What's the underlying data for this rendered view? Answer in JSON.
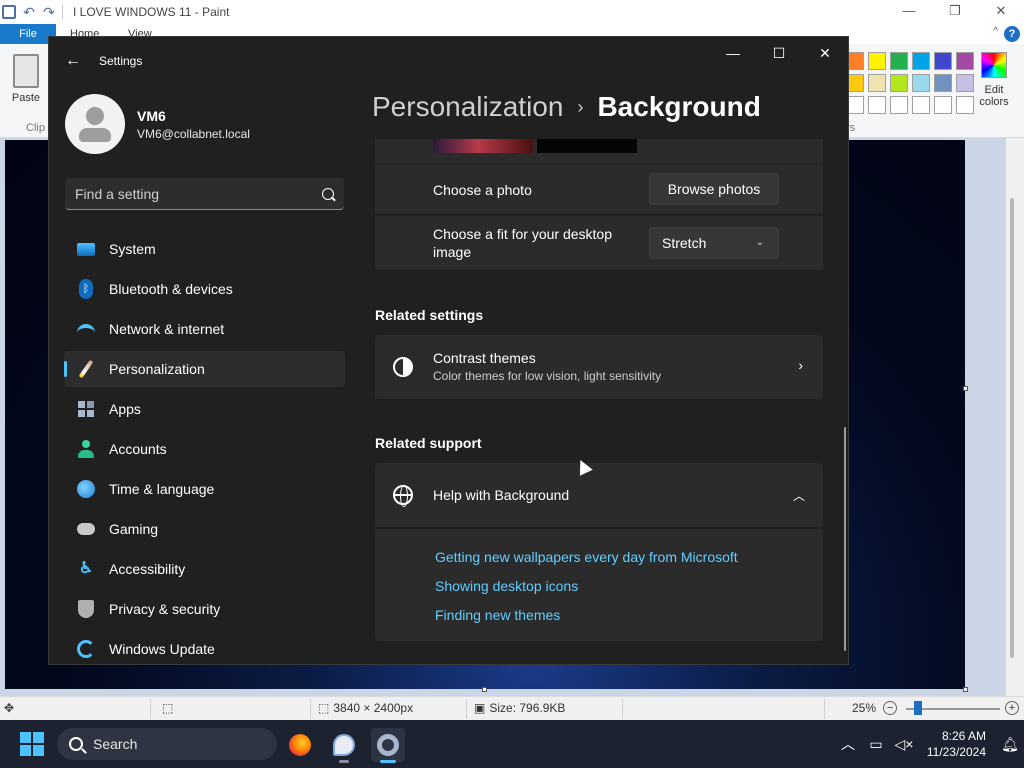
{
  "paint": {
    "title": "I LOVE WINDOWS 11 - Paint",
    "tabs": {
      "file": "File",
      "home": "Home",
      "view": "View"
    },
    "help": "?",
    "collapse": "^",
    "ribbon": {
      "paste": "Paste",
      "clipboard_group": "Clip",
      "colors_group": "rs",
      "edit_colors_line1": "Edit",
      "edit_colors_line2": "colors"
    },
    "palette": [
      "#ff7f27",
      "#fff200",
      "#22b14c",
      "#00a2e8",
      "#3f48cc",
      "#a349a4",
      "#ffc90e",
      "#efe4b0",
      "#b5e61d",
      "#99d9ea",
      "#7092be",
      "#c8bfe7",
      "#ffffff",
      "#ffffff",
      "#ffffff",
      "#ffffff",
      "#ffffff",
      "#ffffff"
    ],
    "status": {
      "dimensions": "3840 × 2400px",
      "size": "Size: 796.9KB",
      "zoom": "25%",
      "zoom_minus": "−",
      "zoom_plus": "+"
    }
  },
  "taskbar": {
    "search": "Search",
    "time": "8:26 AM",
    "date": "11/23/2024",
    "icons": [
      "windows-start-icon",
      "firefox-icon",
      "paint-icon",
      "settings-gear-icon"
    ]
  },
  "settings": {
    "app_title": "Settings",
    "back": "←",
    "window_controls": {
      "minimize": "—",
      "maximize": "☐",
      "close": "✕"
    },
    "user": {
      "name": "VM6",
      "email": "VM6@collabnet.local"
    },
    "search_placeholder": "Find a setting",
    "nav": [
      {
        "label": "System",
        "icon": "system-icon"
      },
      {
        "label": "Bluetooth & devices",
        "icon": "bluetooth-icon"
      },
      {
        "label": "Network & internet",
        "icon": "wifi-icon"
      },
      {
        "label": "Personalization",
        "icon": "brush-icon",
        "selected": true
      },
      {
        "label": "Apps",
        "icon": "apps-icon"
      },
      {
        "label": "Accounts",
        "icon": "accounts-icon"
      },
      {
        "label": "Time & language",
        "icon": "globe-clock-icon"
      },
      {
        "label": "Gaming",
        "icon": "gamepad-icon"
      },
      {
        "label": "Accessibility",
        "icon": "accessibility-icon"
      },
      {
        "label": "Privacy & security",
        "icon": "shield-icon"
      },
      {
        "label": "Windows Update",
        "icon": "update-icon"
      }
    ],
    "breadcrumb": {
      "parent": "Personalization",
      "separator": "›",
      "current": "Background"
    },
    "choose_photo": {
      "label": "Choose a photo",
      "button": "Browse photos"
    },
    "choose_fit": {
      "label_line1": "Choose a fit for your desktop",
      "label_line2": "image",
      "value": "Stretch",
      "chevron": "⌄"
    },
    "related_settings": {
      "title": "Related settings",
      "contrast": {
        "title": "Contrast themes",
        "subtitle": "Color themes for low vision, light sensitivity",
        "chevron": "›"
      }
    },
    "related_support": {
      "title": "Related support",
      "help": {
        "title": "Help with Background",
        "chevron": "︿"
      },
      "links": [
        "Getting new wallpapers every day from Microsoft",
        "Showing desktop icons",
        "Finding new themes"
      ]
    }
  }
}
